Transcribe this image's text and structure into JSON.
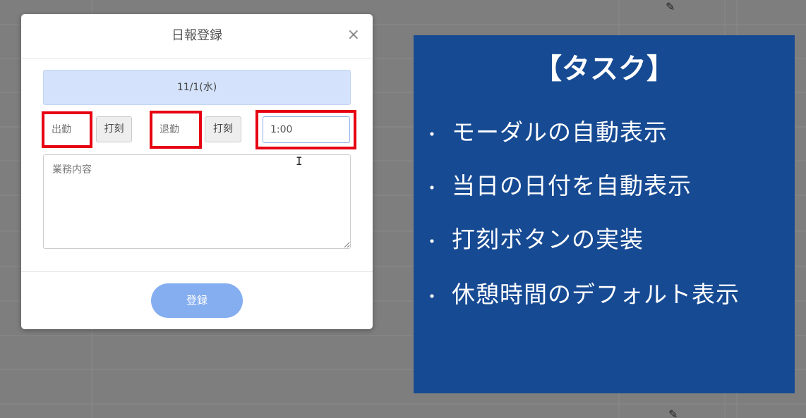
{
  "modal": {
    "title": "日報登録",
    "close_label": "×",
    "date": "11/1(水)",
    "clock_in": {
      "placeholder": "出勤",
      "stamp_label": "打刻"
    },
    "clock_out": {
      "placeholder": "退勤",
      "stamp_label": "打刻"
    },
    "break_time": {
      "value": "1:00"
    },
    "work_content": {
      "placeholder": "業務内容"
    },
    "submit_label": "登録"
  },
  "task_panel": {
    "title": "【タスク】",
    "bullet": "・",
    "items": [
      "モーダルの自動表示",
      "当日の日付を自動表示",
      "打刻ボタンの実装",
      "休憩時間のデフォルト表示"
    ]
  },
  "colors": {
    "overlay": "#7e7e7e",
    "highlight": "#e60012",
    "date_bar": "#d4e3fb",
    "submit": "#85aef0",
    "task_panel": "#164a93"
  },
  "icons": {
    "edit": "pencil-icon",
    "close": "close-icon",
    "text_cursor": "i-beam-cursor-icon"
  }
}
